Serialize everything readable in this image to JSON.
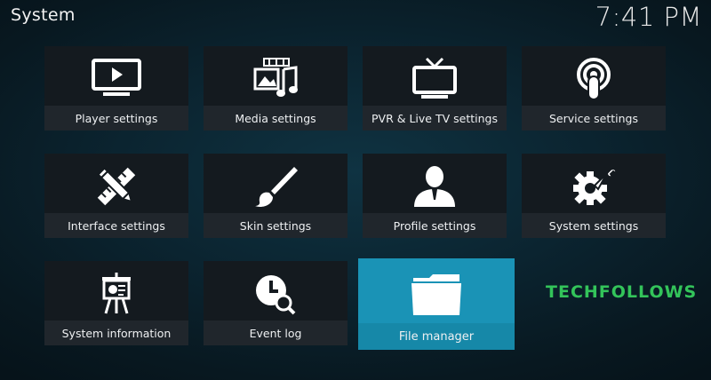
{
  "header": {
    "title": "System",
    "clock": "7:41 PM"
  },
  "tiles": [
    {
      "label": "Player settings",
      "icon": "monitor-play-icon"
    },
    {
      "label": "Media settings",
      "icon": "media-film-music-icon"
    },
    {
      "label": "PVR & Live TV settings",
      "icon": "tv-antenna-icon"
    },
    {
      "label": "Service settings",
      "icon": "podcast-broadcast-icon"
    },
    {
      "label": "Interface settings",
      "icon": "pencil-ruler-icon"
    },
    {
      "label": "Skin settings",
      "icon": "paintbrush-icon"
    },
    {
      "label": "Profile settings",
      "icon": "user-profile-icon"
    },
    {
      "label": "System settings",
      "icon": "gear-wrench-icon"
    },
    {
      "label": "System information",
      "icon": "presentation-easel-icon"
    },
    {
      "label": "Event log",
      "icon": "clock-search-icon"
    },
    {
      "label": "File manager",
      "icon": "folder-icon",
      "focused": true
    }
  ],
  "watermark": {
    "text": "TECHFOLLOWS",
    "color": "#33c45a"
  },
  "colors": {
    "focus": "#1a93b6",
    "tile": "#141a1f",
    "label_bar": "#20262c"
  }
}
